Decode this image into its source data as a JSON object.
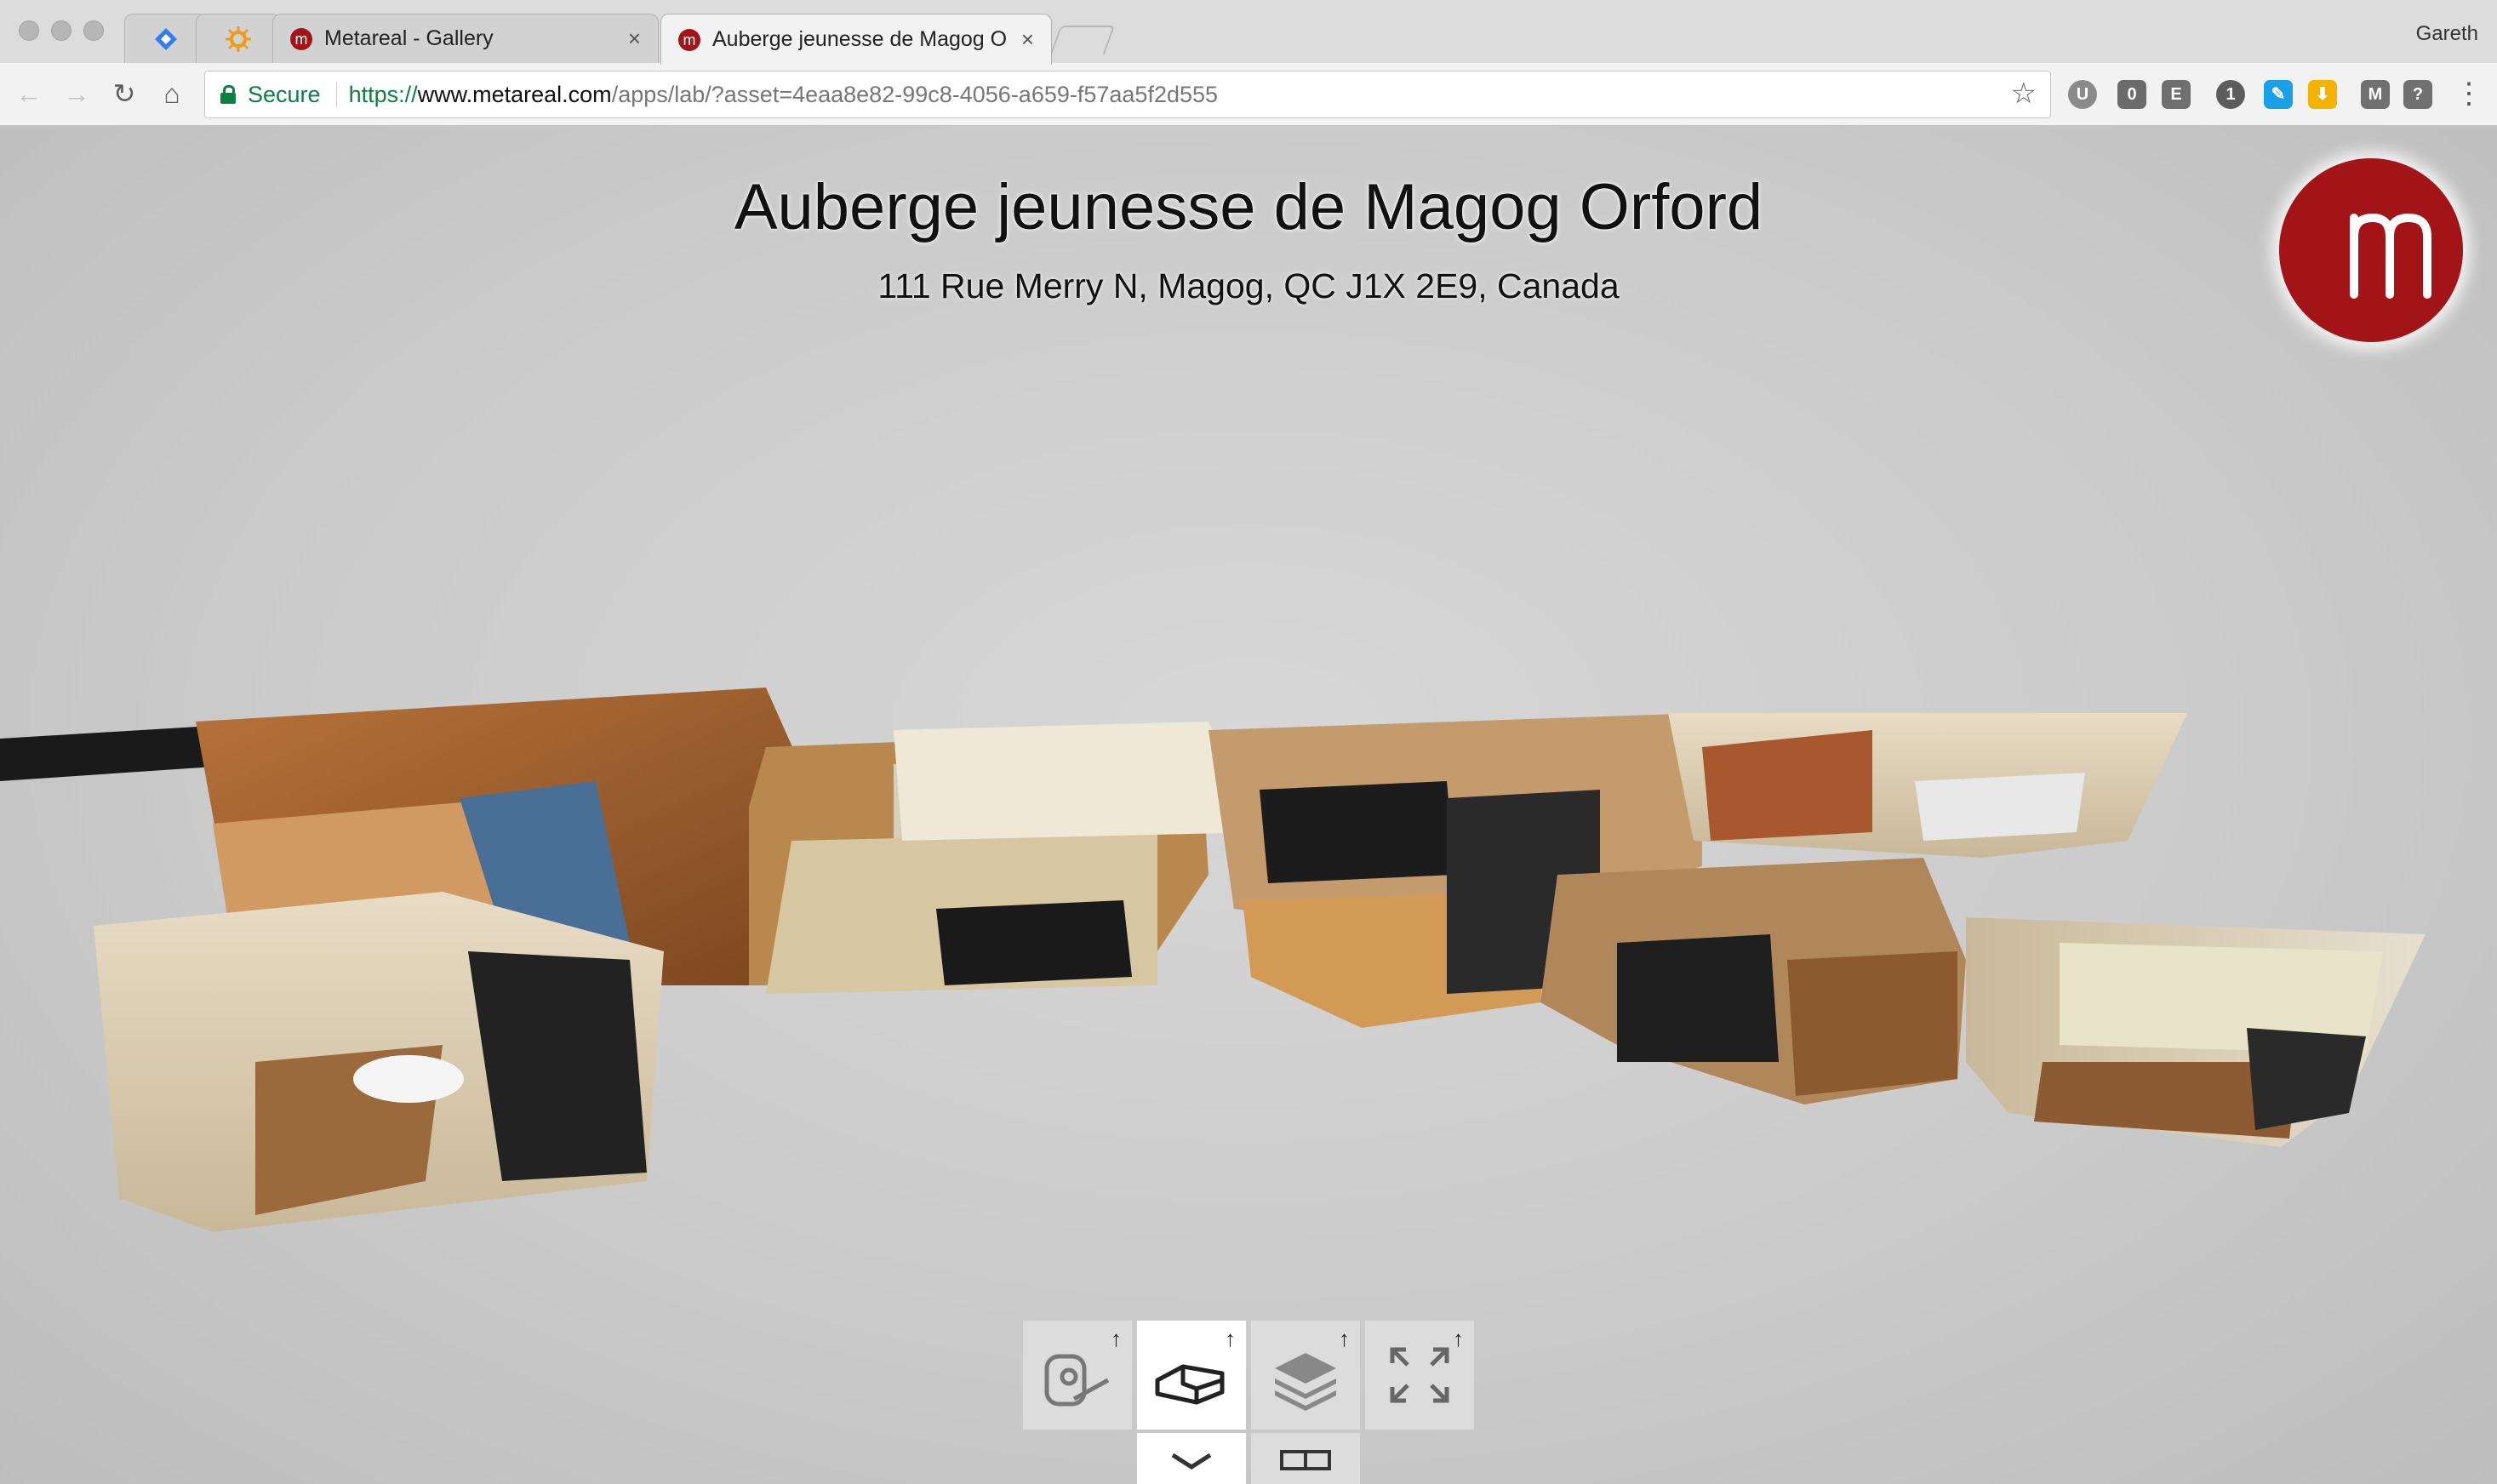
{
  "browser": {
    "tabs": [
      {
        "label": "",
        "icon": "diamond-icon",
        "active": false
      },
      {
        "label": "",
        "icon": "sun-icon",
        "active": false
      },
      {
        "label": "Metareal - Gallery",
        "icon": "metareal-icon",
        "active": false
      },
      {
        "label": "Auberge jeunesse de Magog O",
        "icon": "metareal-icon",
        "active": true
      }
    ],
    "profile_name": "Gareth",
    "secure_label": "Secure",
    "url": {
      "scheme": "https://",
      "host": "www.metareal.com",
      "path": "/apps/lab/?asset=4eaa8e82-99c8-4056-a659-f57aa5f2d555"
    },
    "extensions": [
      {
        "name": "ublock-icon",
        "glyph": "U",
        "color": "#8a8a8a"
      },
      {
        "name": "ghostery-icon",
        "glyph": "0",
        "color": "#6b6b6b"
      },
      {
        "name": "evernote-icon",
        "glyph": "E",
        "color": "#6f6f6f"
      },
      {
        "name": "onepassword-icon",
        "glyph": "1",
        "color": "#5c5c5c"
      },
      {
        "name": "pencil-icon",
        "glyph": "✎",
        "color": "#1aa0e6"
      },
      {
        "name": "download-icon",
        "glyph": "⬇",
        "color": "#f2b400"
      },
      {
        "name": "m-extension-icon",
        "glyph": "M",
        "color": "#707070"
      },
      {
        "name": "lightbulb-icon",
        "glyph": "?",
        "color": "#707070"
      }
    ]
  },
  "page": {
    "title": "Auberge jeunesse de Magog Orford",
    "address": "111 Rue Merry N, Magog, QC J1X 2E9, Canada",
    "brand_color": "#a31419"
  },
  "controls": [
    {
      "name": "measure-tool-button",
      "icon": "tape-measure-icon",
      "active": false
    },
    {
      "name": "dollhouse-view-button",
      "icon": "dollhouse-icon",
      "active": true
    },
    {
      "name": "floors-button",
      "icon": "layers-icon",
      "active": false
    },
    {
      "name": "fullscreen-button",
      "icon": "expand-icon",
      "active": false
    }
  ],
  "sub_controls": [
    {
      "name": "collapse-button",
      "icon": "chevron-down-icon"
    },
    {
      "name": "floorplan-toggle-button",
      "icon": "floorplan-icon"
    }
  ]
}
